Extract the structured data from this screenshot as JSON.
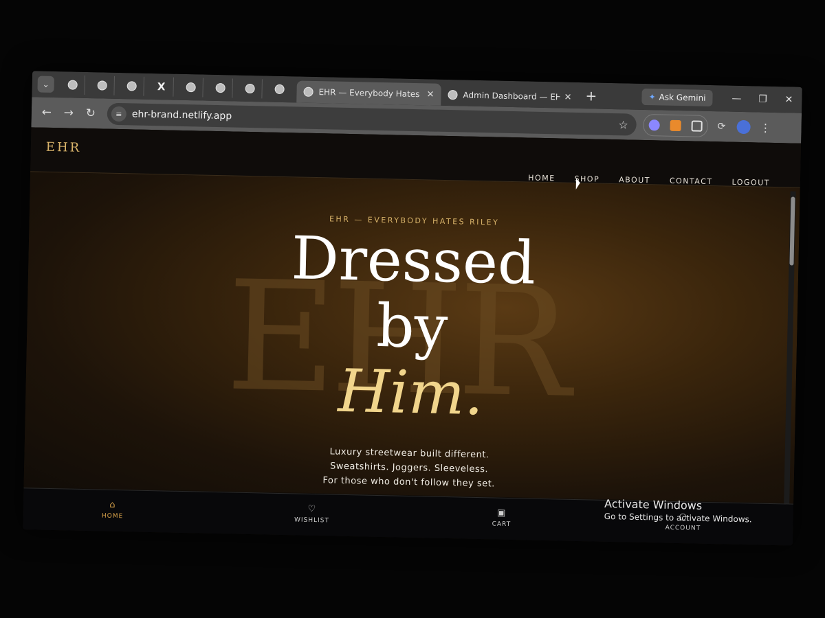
{
  "browser": {
    "tabs": {
      "pinned_count": 8,
      "active": {
        "title": "EHR — Everybody Hates Riley"
      },
      "second": {
        "title": "Admin Dashboard — EHR"
      }
    },
    "gemini_label": "Ask Gemini",
    "url": "ehr-brand.netlify.app"
  },
  "site": {
    "brand": "EHR",
    "nav": [
      "HOME",
      "SHOP",
      "ABOUT",
      "CONTACT",
      "LOGOUT"
    ],
    "hero": {
      "kicker": "EHR — EVERYBODY HATES RILEY",
      "line1": "Dressed",
      "line2": "by",
      "line3": "Him.",
      "watermark": "EHR",
      "tagline1": "Luxury streetwear built different.",
      "tagline2": "Sweatshirts. Joggers. Sleeveless.",
      "tagline3": "For those who don't follow they set."
    },
    "bottom_nav": [
      "HOME",
      "WISHLIST",
      "CART",
      "ACCOUNT"
    ]
  },
  "os": {
    "activate_title": "Activate Windows",
    "activate_sub": "Go to Settings to activate Windows."
  }
}
